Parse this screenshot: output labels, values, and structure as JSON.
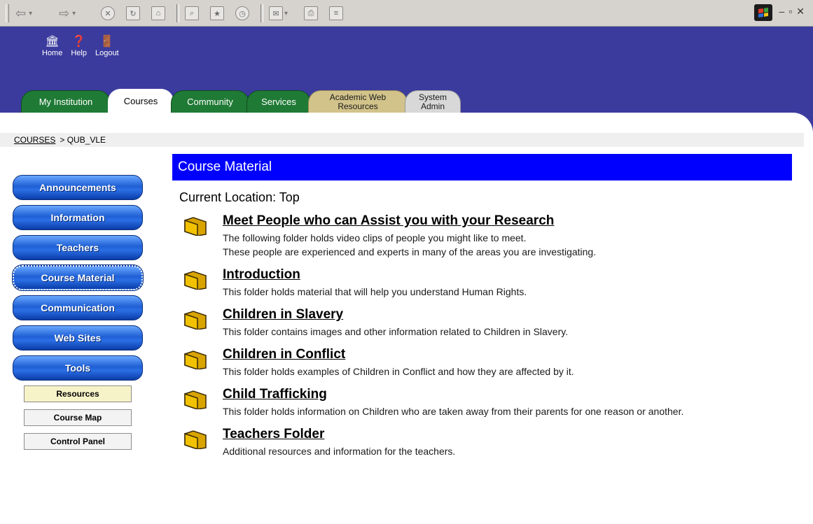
{
  "header": {
    "top_icons": [
      {
        "label": "Home",
        "icon": "institution-icon"
      },
      {
        "label": "Help",
        "icon": "help-icon"
      },
      {
        "label": "Logout",
        "icon": "logout-icon"
      }
    ],
    "tabs": [
      {
        "label": "My Institution",
        "active": false
      },
      {
        "label": "Courses",
        "active": true
      },
      {
        "label": "Community",
        "active": false
      },
      {
        "label": "Services",
        "active": false
      },
      {
        "label": "Academic Web Resources",
        "active": false
      },
      {
        "label": "System Admin",
        "active": false
      }
    ],
    "tab_colors": {
      "default": "#1f7a35",
      "academic": "#d2c38a",
      "system": "#d8d8d8",
      "banner": "#3b3b9e"
    }
  },
  "breadcrumb": {
    "link": "COURSES",
    "current": "QUB_VLE"
  },
  "sidebar": {
    "buttons": [
      {
        "label": "Announcements"
      },
      {
        "label": "Information"
      },
      {
        "label": "Teachers"
      },
      {
        "label": "Course Material",
        "selected": true
      },
      {
        "label": "Communication"
      },
      {
        "label": "Web Sites"
      },
      {
        "label": "Tools"
      }
    ],
    "sub_buttons": [
      {
        "label": "Resources",
        "highlighted": true
      },
      {
        "label": "Course Map"
      },
      {
        "label": "Control Panel"
      }
    ]
  },
  "main": {
    "title": "Course Material",
    "location": "Current Location: Top",
    "title_bar_color": "#0000ff",
    "folders": [
      {
        "title": "Meet People who can Assist you with your Research",
        "desc": [
          "The following folder holds video clips of people you might like to meet.",
          "These people are experienced and experts in many of the areas you are investigating."
        ]
      },
      {
        "title": "Introduction",
        "desc": [
          "This folder holds material that will help you understand Human Rights."
        ]
      },
      {
        "title": "Children in Slavery",
        "desc": [
          "This folder contains images and other information related to Children in Slavery."
        ]
      },
      {
        "title": "Children in Conflict",
        "desc": [
          "This folder holds examples of Children in Conflict and how they are affected by it."
        ]
      },
      {
        "title": "Child Trafficking",
        "desc": [
          "This folder holds information on Children who are taken away from their parents for one reason or another."
        ]
      },
      {
        "title": "Teachers Folder",
        "desc": [
          "Additional resources and information for the teachers."
        ]
      }
    ]
  }
}
